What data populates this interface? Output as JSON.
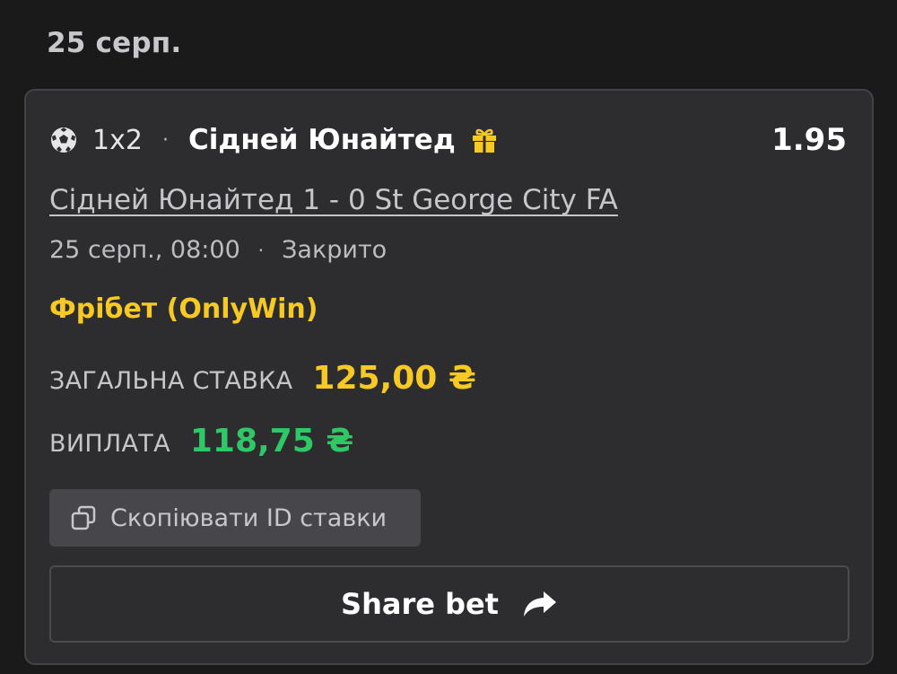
{
  "date_header": "25 серп.",
  "bet": {
    "sport_icon": "soccer-ball-icon",
    "market": "1x2",
    "separator": "·",
    "selection": "Сідней Юнайтед",
    "gift_icon": "gift-icon",
    "odds": "1.95",
    "match": "Сідней Юнайтед 1 - 0 St George City FA",
    "datetime": "25 серп., 08:00",
    "status": "Закрито",
    "bet_type": "Фрібет (OnlyWin)",
    "stake_label": "ЗАГАЛЬНА СТАВКА",
    "stake_value": "125,00 ₴",
    "payout_label": "ВИПЛАТА",
    "payout_value": "118,75 ₴"
  },
  "buttons": {
    "copy_label": "Скопіювати ID ставки",
    "copy_icon": "copy-icon",
    "share_label": "Share bet",
    "share_icon": "share-arrow-icon"
  },
  "colors": {
    "background": "#1a1a1b",
    "card": "#2d2d30",
    "accent_yellow": "#f7c924",
    "payout_green": "#2fc866"
  }
}
